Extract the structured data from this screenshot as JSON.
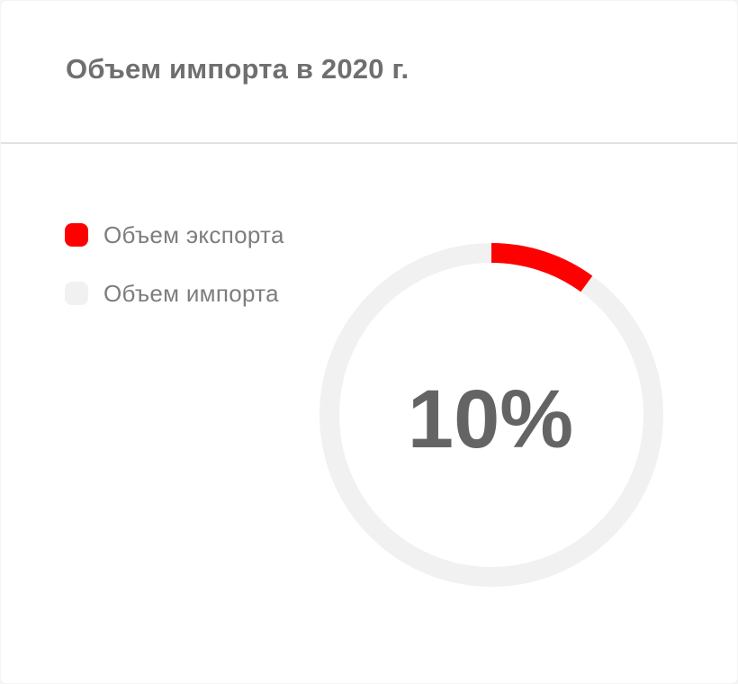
{
  "title": "Объем импорта в 2020 г.",
  "colors": {
    "export": "#ff0000",
    "import": "#f1f1f1"
  },
  "chart_data": {
    "type": "pie",
    "variant": "donut",
    "series": [
      {
        "name": "Объем экспорта",
        "value": 10
      },
      {
        "name": "Объем импорта",
        "value": 90
      }
    ],
    "center_label": "10%",
    "legend_position": "top-left"
  }
}
